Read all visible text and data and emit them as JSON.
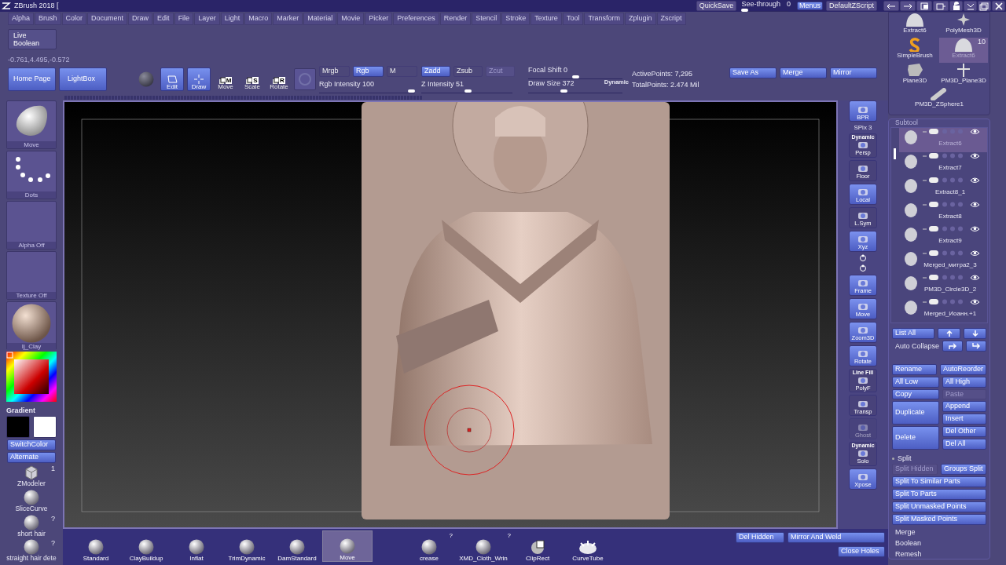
{
  "window": {
    "title": "ZBrush 2018 ["
  },
  "title_bar": {
    "quicksave": "QuickSave",
    "see_through": {
      "label": "See-through",
      "value": "0",
      "level": 0
    },
    "menus": {
      "label": "Menus",
      "selected": true
    },
    "script": "DefaultZScript"
  },
  "menu_bar": [
    "Alpha",
    "Brush",
    "Color",
    "Document",
    "Draw",
    "Edit",
    "File",
    "Layer",
    "Light",
    "Macro",
    "Marker",
    "Material",
    "Movie",
    "Picker",
    "Preferences",
    "Render",
    "Stencil",
    "Stroke",
    "Texture",
    "Tool",
    "Transform",
    "Zplugin",
    "Zscript"
  ],
  "live_boolean": "Live Boolean",
  "coordinates": "-0.761,4.495,-0.572",
  "toolbar": {
    "home_page": "Home Page",
    "lightbox": "LightBox",
    "modes": [
      {
        "label": "Edit",
        "kind": "edit",
        "selected": true
      },
      {
        "label": "Draw",
        "kind": "draw",
        "selected": true
      },
      {
        "label": "Move",
        "kind": "lettered",
        "letter": "M",
        "selected": false
      },
      {
        "label": "Scale",
        "kind": "lettered",
        "letter": "S",
        "selected": false
      },
      {
        "label": "Rotate",
        "kind": "lettered",
        "letter": "R",
        "selected": false
      }
    ],
    "color_modes": [
      {
        "label": "Mrgb",
        "selected": false
      },
      {
        "label": "Rgb",
        "selected": true
      },
      {
        "label": "M",
        "selected": false
      }
    ],
    "z_modes": [
      {
        "label": "Zadd",
        "selected": true,
        "disabled": false
      },
      {
        "label": "Zsub",
        "selected": false,
        "disabled": false
      },
      {
        "label": "Zcut",
        "selected": false,
        "disabled": true
      }
    ],
    "rgb_intensity": {
      "label": "Rgb Intensity 100",
      "level": 1
    },
    "z_intensity": {
      "label": "Z Intensity 51",
      "level": 0.51
    },
    "focal_shift": {
      "label": "Focal Shift 0",
      "level": 0.5
    },
    "draw_size": {
      "label": "Draw Size 372",
      "level": 0.37,
      "dynamic": "Dynamic"
    },
    "active_points": "ActivePoints: 7,295",
    "total_points": "TotalPoints: 2.474 Mil",
    "buttons": [
      "Save As",
      "Merge",
      "Mirror"
    ]
  },
  "left_shelf": {
    "tiles": [
      {
        "kind": "brush",
        "label": "Move"
      },
      {
        "kind": "stroke",
        "label": "Dots"
      },
      {
        "kind": "empty",
        "label": "Alpha Off"
      },
      {
        "kind": "empty",
        "label": "Texture Off"
      },
      {
        "kind": "material",
        "label": "Ij_Clay"
      }
    ],
    "gradient": "Gradient",
    "swatches": [
      {
        "color": "#000000"
      },
      {
        "color": "#ffffff"
      }
    ],
    "switch_color": "SwitchColor",
    "alternate": "Alternate",
    "brushes": [
      {
        "label": "ZModeler",
        "kind": "cube",
        "mark": "1"
      },
      {
        "label": "SliceCurve",
        "kind": "sphere"
      },
      {
        "label": "short hair",
        "kind": "sphere",
        "mark": "?"
      },
      {
        "label": "straight hair dete",
        "kind": "sphere",
        "mark": "?"
      }
    ]
  },
  "right_shelf": [
    {
      "kind": "button",
      "label": "BPR",
      "on": true
    },
    {
      "kind": "text",
      "label": "SPix 3"
    },
    {
      "kind": "button",
      "label": "Persp",
      "caption": "Dynamic",
      "on": false
    },
    {
      "kind": "button",
      "label": "Floor",
      "on": false
    },
    {
      "kind": "button",
      "label": "Local",
      "on": true
    },
    {
      "kind": "button",
      "label": "L.Sym",
      "on": false
    },
    {
      "kind": "button",
      "label": "Xyz",
      "on": true
    },
    {
      "kind": "icon"
    },
    {
      "kind": "icon"
    },
    {
      "kind": "button",
      "label": "Frame",
      "on": true
    },
    {
      "kind": "button",
      "label": "Move",
      "on": true
    },
    {
      "kind": "button",
      "label": "Zoom3D",
      "on": true
    },
    {
      "kind": "button",
      "label": "Rotate",
      "on": true
    },
    {
      "kind": "button",
      "label": "PolyF",
      "caption": "Line Fill",
      "on": false
    },
    {
      "kind": "button",
      "label": "Transp",
      "on": false
    },
    {
      "kind": "button",
      "label": "Ghost",
      "on": false,
      "disabled": true
    },
    {
      "kind": "button",
      "label": "Solo",
      "caption": "Dynamic",
      "on": false
    },
    {
      "kind": "button",
      "label": "Xpose",
      "on": true
    }
  ],
  "tools": [
    {
      "label": "Extract6",
      "kind": "mesh",
      "selected": false
    },
    {
      "label": "PolyMesh3D",
      "kind": "star",
      "selected": false
    },
    {
      "label": "SimpleBrush",
      "kind": "brush",
      "selected": false
    },
    {
      "label": "Extract6",
      "kind": "mesh",
      "count": "10",
      "selected": true
    },
    {
      "label": "Plane3D",
      "kind": "plane",
      "selected": false
    },
    {
      "label": "PM3D_Plane3D",
      "kind": "cross",
      "selected": false
    },
    {
      "label": "PM3D_ZSphere1",
      "kind": "zsphere",
      "selected": false
    }
  ],
  "subtool": {
    "title": "Subtool",
    "items": [
      {
        "name": "Extract6",
        "selected": true
      },
      {
        "name": "Extract7",
        "selected": false
      },
      {
        "name": "Extract8_1",
        "selected": false
      },
      {
        "name": "Extract8",
        "selected": false
      },
      {
        "name": "Extract9",
        "selected": false
      },
      {
        "name": "Merged_митра2_3",
        "selected": false
      },
      {
        "name": "PM3D_Circle3D_2",
        "selected": false
      },
      {
        "name": "Merged_Иоанн.+1",
        "selected": false
      }
    ],
    "list_all": "List All",
    "auto_collapse": "Auto Collapse",
    "action_rows": [
      {
        "left": {
          "label": "Rename"
        },
        "right": [
          {
            "label": "AutoReorder",
            "disabled": false
          }
        ]
      },
      {
        "left": {
          "label": "All Low"
        },
        "right": [
          {
            "label": "All High",
            "disabled": false
          }
        ]
      },
      {
        "left": {
          "label": "Copy"
        },
        "right": [
          {
            "label": "Paste",
            "disabled": true
          }
        ]
      },
      {
        "left": {
          "label": "Duplicate"
        },
        "right": [
          {
            "label": "Append",
            "disabled": false
          },
          {
            "label": "Insert",
            "disabled": false
          }
        ]
      },
      {
        "left": {
          "label": "Delete"
        },
        "right": [
          {
            "label": "Del Other",
            "disabled": false
          },
          {
            "label": "Del All",
            "disabled": false
          }
        ]
      }
    ],
    "split": {
      "title": "Split",
      "expanded": true,
      "pair": [
        {
          "label": "Split Hidden",
          "disabled": true
        },
        {
          "label": "Groups Split",
          "disabled": false
        }
      ],
      "buttons": [
        "Split To Similar Parts",
        "Split To Parts",
        "Split Unmasked Points",
        "Split Masked Points"
      ]
    },
    "sections": [
      "Merge",
      "Boolean",
      "Remesh"
    ]
  },
  "bottom_shelf": {
    "brushes": [
      {
        "label": "Standard",
        "selected": false
      },
      {
        "label": "ClayBuildup",
        "selected": false
      },
      {
        "label": "Inflat",
        "selected": false
      },
      {
        "label": "TrimDynamic",
        "selected": false
      },
      {
        "label": "DamStandard",
        "selected": false
      },
      {
        "label": "Move",
        "selected": true
      }
    ],
    "brushes2": [
      {
        "label": "crease",
        "mark": "?",
        "kind": "sphere"
      },
      {
        "label": "XMD_Cloth_Wrin",
        "mark": "?",
        "kind": "sphere"
      },
      {
        "label": "ClipRect",
        "kind": "clip"
      },
      {
        "label": "CurveTube",
        "kind": "tube"
      }
    ],
    "del_hidden": "Del Hidden",
    "mirror_weld": "Mirror And Weld",
    "close_holes": "Close Holes"
  }
}
